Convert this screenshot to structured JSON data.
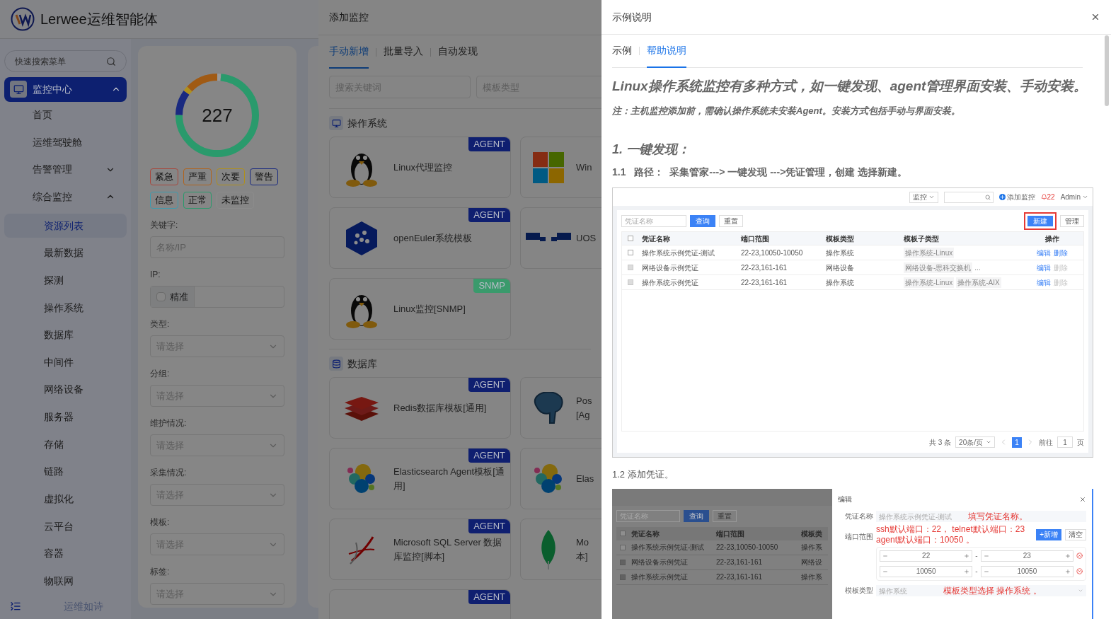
{
  "app": {
    "logo_text": "Lerwee运维智能体",
    "menu_search": {
      "placeholder": "快速搜索菜单"
    },
    "menu": [
      {
        "label": "监控中心",
        "selected": true,
        "expanded": true,
        "children": [
          {
            "label": "首页",
            "selected": false
          },
          {
            "label": "运维驾驶舱",
            "selected": false
          },
          {
            "label": "告警管理",
            "selected": false,
            "expanded": false
          },
          {
            "label": "综合监控",
            "selected": false,
            "expanded": true,
            "children": [
              {
                "label": "资源列表",
                "selected": true
              },
              {
                "label": "最新数据",
                "selected": false
              },
              {
                "label": "探测",
                "selected": false
              },
              {
                "label": "操作系统",
                "selected": false
              },
              {
                "label": "数据库",
                "selected": false
              },
              {
                "label": "中间件",
                "selected": false
              },
              {
                "label": "网络设备",
                "selected": false
              },
              {
                "label": "服务器",
                "selected": false
              },
              {
                "label": "存储",
                "selected": false
              },
              {
                "label": "链路",
                "selected": false
              },
              {
                "label": "虚拟化",
                "selected": false
              },
              {
                "label": "云平台",
                "selected": false
              },
              {
                "label": "容器",
                "selected": false
              },
              {
                "label": "物联网",
                "selected": false
              }
            ]
          }
        ]
      }
    ],
    "footer_text": "运维如诗"
  },
  "filter": {
    "total": "227",
    "levels": [
      {
        "label": "紧急",
        "color": "#a8473c"
      },
      {
        "label": "严重",
        "color": "#b0641e"
      },
      {
        "label": "次要",
        "color": "#b0901c"
      },
      {
        "label": "警告",
        "color": "#1a2a80"
      },
      {
        "label": "信息",
        "color": "#3c9cb0"
      },
      {
        "label": "正常",
        "color": "#2a9a6c"
      },
      {
        "label": "未监控",
        "color": "#8c8c8c"
      }
    ],
    "fields": [
      {
        "label": "关键字:",
        "kind": "input",
        "placeholder": "名称/IP"
      },
      {
        "label": "IP:",
        "kind": "ip",
        "checkbox_label": "精准",
        "checked": false
      },
      {
        "label": "类型:",
        "kind": "select",
        "placeholder": "请选择"
      },
      {
        "label": "分组:",
        "kind": "select",
        "placeholder": "请选择"
      },
      {
        "label": "维护情况:",
        "kind": "select",
        "placeholder": "请选择"
      },
      {
        "label": "采集情况:",
        "kind": "select",
        "placeholder": "请选择"
      },
      {
        "label": "模板:",
        "kind": "select",
        "placeholder": "请选择"
      },
      {
        "label": "标签:",
        "kind": "select",
        "placeholder": "请选择"
      }
    ]
  },
  "add_monitor": {
    "title": "添加监控",
    "tabs": [
      {
        "label": "手动新增",
        "selected": true
      },
      {
        "label": "批量导入",
        "selected": false
      },
      {
        "label": "自动发现",
        "selected": false
      }
    ],
    "search": {
      "placeholder": "搜索关键词"
    },
    "type_select": {
      "placeholder": "模板类型"
    },
    "sections": [
      {
        "title": "操作系统",
        "kind": "os",
        "cards": [
          {
            "name": "Linux代理监控",
            "badge": "AGENT",
            "color": "#0f1f70",
            "kind": "penguin"
          },
          {
            "name_lines": [
              "Win"
            ],
            "kind": "windows"
          },
          {
            "name": "openEuler系统模板",
            "badge": "AGENT",
            "color": "#0f1f70",
            "kind": "euler"
          },
          {
            "name_lines": [
              "UOS"
            ],
            "kind": "uos"
          },
          {
            "name": "Linux监控[SNMP]",
            "badge": "SNMP",
            "color": "#3a9a6c",
            "kind": "penguin"
          }
        ]
      },
      {
        "title": "数据库",
        "kind": "db",
        "cards": [
          {
            "name": "Redis数据库模板[通用]",
            "badge": "AGENT",
            "color": "#0f1f70",
            "kind": "redis"
          },
          {
            "name_lines": [
              "Pos",
              "[Ag"
            ],
            "kind": "postgres"
          },
          {
            "name": "Elasticsearch Agent模板[通用]",
            "badge": "AGENT",
            "color": "#0f1f70",
            "kind": "elastic"
          },
          {
            "name_lines": [
              "Elas"
            ],
            "kind": "elastic"
          },
          {
            "name": "Microsoft SQL Server 数据库监控[脚本]",
            "badge": "AGENT",
            "color": "#0f1f70",
            "kind": "sqlserver"
          },
          {
            "name_lines": [
              "Mo",
              "本]"
            ],
            "kind": "mongo"
          },
          {
            "badge": "AGENT",
            "color": "#0f1f70",
            "kind": "partial"
          }
        ]
      }
    ]
  },
  "help": {
    "title": "示例说明",
    "tabs": [
      {
        "label": "示例",
        "selected": false
      },
      {
        "label": "帮助说明",
        "selected": true
      }
    ],
    "heading": "Linux操作系统监控有多种方式，如一键发现、agent管理界面安装、手动安装。",
    "note": "注：主机监控添加前，需确认操作系统未安装Agent。安装方式包括手动与界面安装。",
    "step_title": "1. 一键发现：",
    "step_number": "1.1",
    "step_path": "路径：  采集管家---> 一键发现 --->凭证管理，创建 选择新建。",
    "screenshot1": {
      "header": {
        "select": "监控",
        "add_link": "添加监控",
        "alert_count": "22",
        "user": "Admin"
      },
      "query_placeholder": "凭证名称",
      "query_button": "查询",
      "reset_button": "重置",
      "new_button": "新建",
      "manage_button": "管理",
      "select_all_checked": false,
      "columns": [
        "凭证名称",
        "端口范围",
        "模板类型",
        "模板子类型",
        "操作"
      ],
      "rows": [
        {
          "checked": false,
          "disabled": false,
          "cells": [
            "操作系统示例凭证-测试",
            "22-23,10050-10050",
            "操作系统"
          ],
          "tags": [
            "操作系统-Linux"
          ],
          "actions": [
            {
              "label": "编辑",
              "disabled": false
            },
            {
              "label": "删除",
              "disabled": false
            }
          ]
        },
        {
          "checked": false,
          "disabled": true,
          "cells": [
            "网络设备示例凭证",
            "22-23,161-161",
            "网络设备"
          ],
          "tags": [
            "网络设备-思科交换机"
          ],
          "more": "...",
          "actions": [
            {
              "label": "编辑",
              "disabled": false
            },
            {
              "label": "删除",
              "disabled": true
            }
          ]
        },
        {
          "checked": false,
          "disabled": true,
          "cells": [
            "操作系统示例凭证",
            "22-23,161-161",
            "操作系统"
          ],
          "tags": [
            "操作系统-Linux",
            "操作系统-AIX"
          ],
          "actions": [
            {
              "label": "编辑",
              "disabled": false
            },
            {
              "label": "删除",
              "disabled": true
            }
          ]
        }
      ],
      "pagination": {
        "total": "共 3 条",
        "page_size": "20条/页",
        "page": "1",
        "goto_label": "前往",
        "goto_value": "1",
        "goto_suffix": "页"
      }
    },
    "caption": "1.2 添加凭证。",
    "screenshot2": {
      "query_placeholder": "凭证名称",
      "query_button": "查询",
      "reset_button": "重置",
      "select_all_checked": false,
      "columns": [
        "凭证名称",
        "端口范围",
        "模板类"
      ],
      "rows": [
        {
          "checked": false,
          "disabled": false,
          "cells": [
            "操作系统示例凭证-测试",
            "22-23,10050-10050",
            "操作系"
          ]
        },
        {
          "checked": false,
          "disabled": true,
          "cells": [
            "网络设备示例凭证",
            "22-23,161-161",
            "网络设"
          ]
        },
        {
          "checked": false,
          "disabled": true,
          "cells": [
            "操作系统示例凭证",
            "22-23,161-161",
            "操作系"
          ]
        }
      ],
      "dialog": {
        "title": "编辑",
        "name_field": {
          "label": "凭证名称",
          "value": "操作系统示例凭证-测试",
          "note": "填写凭证名称。"
        },
        "port_field": {
          "label": "端口范围",
          "notes": [
            "ssh默认端口：22， telnet默认端口：23",
            "agent默认端口：10050 。"
          ],
          "add_button": "+新增",
          "clear_button": "清空",
          "ranges": [
            {
              "from": "22",
              "sep": "-",
              "to": "23"
            },
            {
              "from": "10050",
              "sep": "-",
              "to": "10050"
            }
          ]
        },
        "type_field": {
          "label": "模板类型",
          "value": "操作系统",
          "note": "模板类型选择 操作系统 。"
        }
      }
    }
  }
}
